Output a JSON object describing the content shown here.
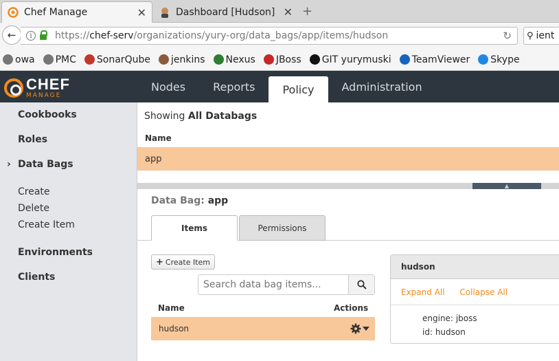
{
  "browser": {
    "tabs": [
      {
        "title": "Chef Manage",
        "active": true
      },
      {
        "title": "Dashboard [Hudson]",
        "active": false
      }
    ],
    "close_glyph": "✕",
    "new_tab_glyph": "+",
    "url_prefix": "https://",
    "url_host": "chef-serv",
    "url_path": "/organizations/yury-org/data_bags/app/items/hudson",
    "search_text": "ient",
    "bookmarks": [
      {
        "label": "owa",
        "icon": "globe-icon",
        "color": "#777777"
      },
      {
        "label": "PMC",
        "icon": "globe-icon",
        "color": "#777777"
      },
      {
        "label": "SonarQube",
        "icon": "person-icon",
        "color": "#c0392b"
      },
      {
        "label": "jenkins",
        "icon": "jenkins-icon",
        "color": "#8e5a3c"
      },
      {
        "label": "Nexus",
        "icon": "nexus-icon",
        "color": "#2e7d32"
      },
      {
        "label": "JBoss",
        "icon": "jboss-icon",
        "color": "#c62828"
      },
      {
        "label": "GIT yurymuski",
        "icon": "github-icon",
        "color": "#111111"
      },
      {
        "label": "TeamViewer",
        "icon": "teamviewer-icon",
        "color": "#1565c0"
      },
      {
        "label": "Skype",
        "icon": "skype-icon",
        "color": "#1e88e5"
      }
    ]
  },
  "app": {
    "logo_main": "CHEF",
    "logo_sub": "MANAGE",
    "brand_color": "#f18b21",
    "nav": [
      "Nodes",
      "Reports",
      "Policy",
      "Administration"
    ],
    "nav_active": "Policy"
  },
  "sidebar": {
    "cookbooks": "Cookbooks",
    "roles": "Roles",
    "data_bags": "Data Bags",
    "create": "Create",
    "delete": "Delete",
    "create_item": "Create Item",
    "environments": "Environments",
    "clients": "Clients"
  },
  "databags": {
    "showing_prefix": "Showing",
    "showing_value": "All Databags",
    "column_name": "Name",
    "rows": [
      "app"
    ]
  },
  "databag": {
    "title_prefix": "Data Bag:",
    "title_value": "app",
    "tabs": [
      "Items",
      "Permissions"
    ],
    "create_item_button": "Create Item",
    "search_placeholder": "Search data bag items...",
    "col_name": "Name",
    "col_actions": "Actions",
    "items": [
      "hudson"
    ]
  },
  "detail": {
    "title": "hudson",
    "expand_all": "Expand All",
    "collapse_all": "Collapse All",
    "fields": [
      {
        "key": "engine:",
        "value": "jboss"
      },
      {
        "key": "id:",
        "value": "hudson"
      }
    ]
  }
}
